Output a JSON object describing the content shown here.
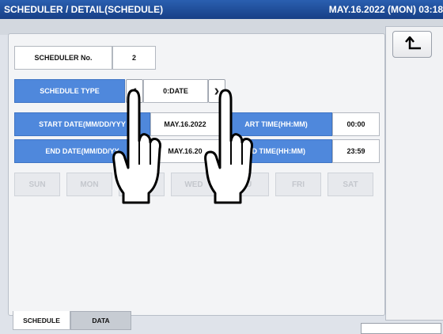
{
  "header": {
    "title": "SCHEDULER / DETAIL(SCHEDULE)",
    "datetime": "MAY.16.2022 (MON) 03:18"
  },
  "back_button": {
    "icon": "return-arrow-icon"
  },
  "scheduler_no": {
    "label": "SCHEDULER No.",
    "value": "2"
  },
  "schedule_type": {
    "label": "SCHEDULE TYPE",
    "value": "0:DATE",
    "prev_icon": "chevron-left-icon",
    "next_icon": "chevron-right-icon"
  },
  "start_date": {
    "label": "START DATE(MM/DD/YYY",
    "value": "MAY.16.2022"
  },
  "start_time": {
    "label": "ART TIME(HH:MM)",
    "value": "00:00"
  },
  "end_date": {
    "label": "END DATE(MM/DD/YY",
    "value": "MAY.16.20"
  },
  "end_time": {
    "label": "ND TIME(HH:MM)",
    "value": "23:59"
  },
  "days": [
    "SUN",
    "MON",
    "",
    "WED",
    "HU",
    "FRI",
    "SAT"
  ],
  "tabs": [
    {
      "label": "SCHEDULE",
      "active": true
    },
    {
      "label": "DATA",
      "active": false
    }
  ],
  "overlay": {
    "icon": "pointing-hand-icon"
  }
}
